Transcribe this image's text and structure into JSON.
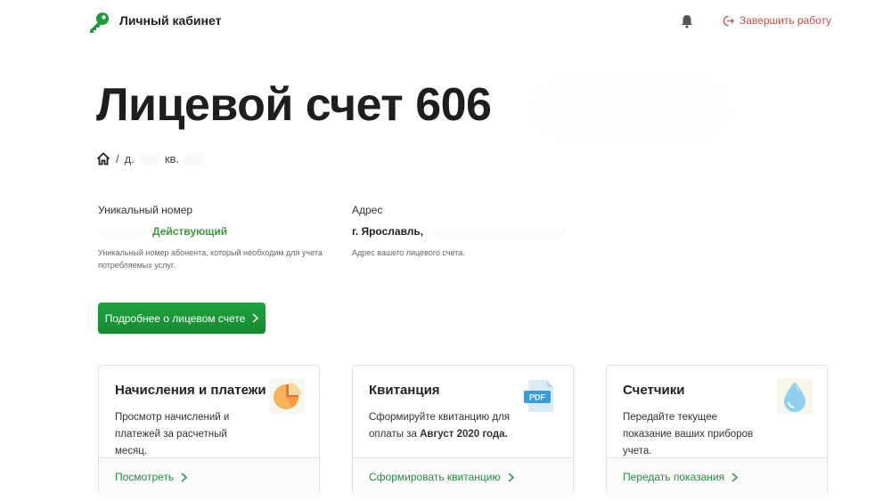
{
  "header": {
    "brand": "Личный кабинет",
    "logout_label": "Завершить работу",
    "icons": {
      "logo": "key-icon",
      "notifications": "bell-icon",
      "logout": "logout-icon"
    }
  },
  "page": {
    "title": "Лицевой счет 606"
  },
  "breadcrumb": {
    "sep": "/",
    "house": "д.",
    "apt": "кв."
  },
  "account": {
    "unique_label": "Уникальный номер",
    "status": "Действующий",
    "unique_note": "Уникальный номер абонента, который необходим для учета потребляемых услуг.",
    "address_label": "Адрес",
    "address_value": "г. Ярославль,",
    "address_note": "Адрес вашего лицевого счета."
  },
  "details_button": "Подробнее о лицевом счете",
  "cards": [
    {
      "title": "Начисления и платежи",
      "desc": "Просмотр начислений и платежей за расчетный месяц.",
      "link": "Посмотреть",
      "icon": "pie-chart-icon"
    },
    {
      "title": "Квитанция",
      "desc_before": "Сформируйте квитанцию для оплаты за",
      "desc_bold": "Август 2020 года.",
      "link": "Сформировать квитанцию",
      "icon": "pdf-file-icon",
      "icon_text": "PDF"
    },
    {
      "title": "Счетчики",
      "desc": "Передайте текущее показание ваших приборов учета.",
      "link": "Передать показания",
      "icon": "water-drop-icon"
    }
  ],
  "colors": {
    "accent_green": "#1e8f3a",
    "button_green": "#1a9638",
    "logout_red": "#c0504d",
    "status_green": "#3a9a3a"
  }
}
